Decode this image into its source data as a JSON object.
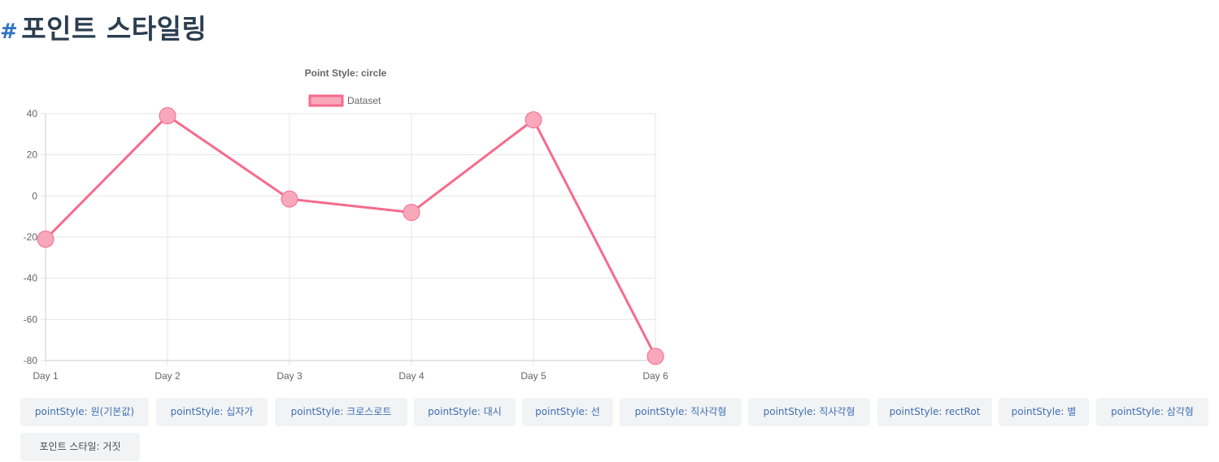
{
  "page": {
    "hash": "#",
    "title": "포인트 스타일링"
  },
  "buttons": [
    "pointStyle: 원(기본값)",
    "pointStyle: 십자가",
    "pointStyle: 크로스로트",
    "pointStyle: 대시",
    "pointStyle: 선",
    "pointStyle: 직사각형",
    "pointStyle: 직사각형",
    "pointStyle: rectRot",
    "pointStyle: 별",
    "pointStyle: 삼각형",
    "포인트 스타일: 거짓"
  ],
  "colors": {
    "line": "#f56b8c",
    "point_fill": "#f9a8bb",
    "point_border": "#f56b8c",
    "grid": "#e6e6e6",
    "button_text": "#3f6fb5",
    "button_bg": "#f1f3f4"
  },
  "chart_data": {
    "type": "line",
    "title": "Point Style: circle",
    "categories": [
      "Day 1",
      "Day 2",
      "Day 3",
      "Day 4",
      "Day 5",
      "Day 6"
    ],
    "series": [
      {
        "name": "Dataset",
        "values": [
          -21,
          39,
          -1.5,
          -8,
          37,
          -78
        ],
        "point_style": "circle"
      }
    ],
    "y_ticks": [
      40,
      20,
      0,
      -20,
      -40,
      -60,
      -80
    ],
    "ylim": [
      -80,
      40
    ],
    "grid": true,
    "legend_position": "top"
  }
}
